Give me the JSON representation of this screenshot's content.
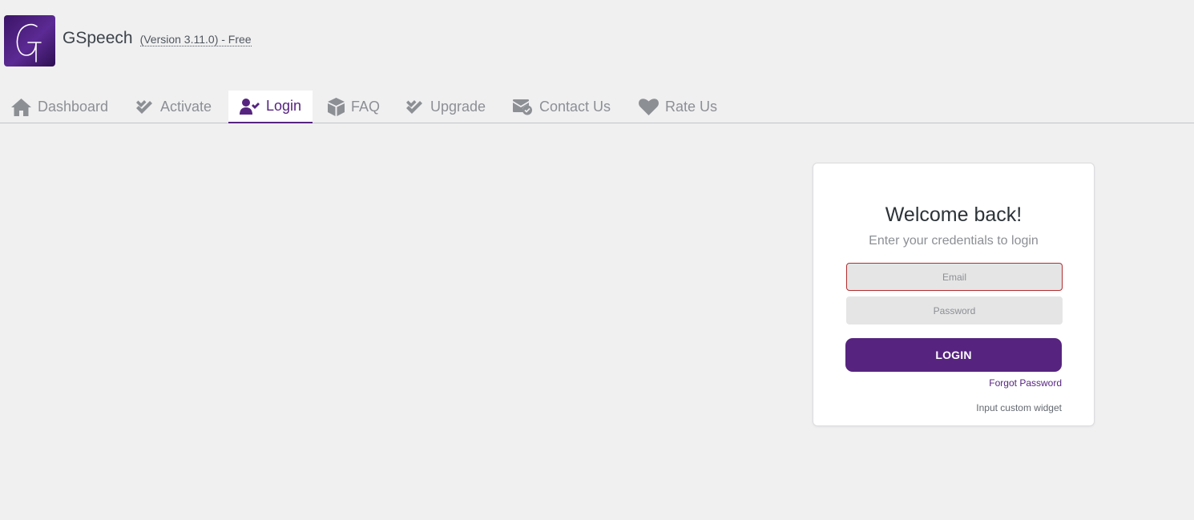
{
  "header": {
    "logo_letter": "G",
    "app_title": "GSpeech",
    "version": "(Version 3.11.0) - Free"
  },
  "tabs": [
    {
      "label": "Dashboard",
      "icon": "home-icon"
    },
    {
      "label": "Activate",
      "icon": "double-check-icon"
    },
    {
      "label": "Login",
      "icon": "user-check-icon",
      "active": true
    },
    {
      "label": "FAQ",
      "icon": "cube-icon"
    },
    {
      "label": "Upgrade",
      "icon": "double-check-icon"
    },
    {
      "label": "Contact Us",
      "icon": "envelope-check-icon"
    },
    {
      "label": "Rate Us",
      "icon": "heart-icon"
    }
  ],
  "login_card": {
    "title": "Welcome back!",
    "subtitle": "Enter your credentials to login",
    "email_placeholder": "Email",
    "password_placeholder": "Password",
    "email_value": "",
    "password_value": "",
    "login_label": "LOGIN",
    "forgot_label": "Forgot Password",
    "widget_text": "Input custom widget"
  },
  "colors": {
    "accent": "#56247f",
    "background": "#f0f0f1",
    "error_border": "#b32d2e",
    "field_bg": "#e5e5e5"
  }
}
